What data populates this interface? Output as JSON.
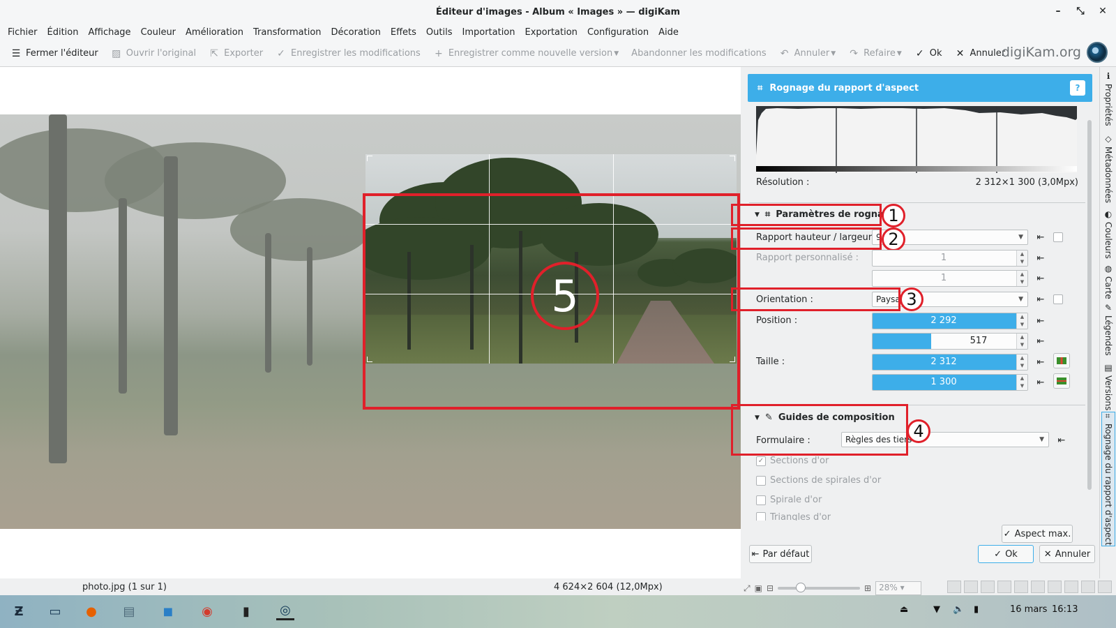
{
  "window": {
    "title": "Éditeur d'images - Album « Images » — digiKam",
    "controls": [
      "–",
      "⤡",
      "✕"
    ]
  },
  "menu": [
    "Fichier",
    "Édition",
    "Affichage",
    "Couleur",
    "Amélioration",
    "Transformation",
    "Décoration",
    "Effets",
    "Outils",
    "Importation",
    "Exportation",
    "Configuration",
    "Aide"
  ],
  "toolbar": {
    "close_editor": "Fermer l'éditeur",
    "open_original": "Ouvrir l'original",
    "export": "Exporter",
    "save_changes": "Enregistrer les modifications",
    "save_new_version": "Enregistrer comme nouvelle version",
    "discard_changes": "Abandonner les modifications",
    "undo": "Annuler",
    "redo": "Refaire",
    "ok": "Ok",
    "cancel": "Annuler",
    "brand": "digiKam.org"
  },
  "panel": {
    "title": "Rognage du rapport d'aspect",
    "help": "?",
    "resolution_label": "Résolution :",
    "resolution_value": "2 312×1 300 (3,0Mpx)",
    "crop_section": "Paramètres de rognage",
    "ratio_label": "Rapport hauteur / largeur :",
    "ratio_value": "9:16",
    "custom_ratio_label": "Rapport personnalisé :",
    "custom_ratio_1": "1",
    "custom_ratio_2": "1",
    "orientation_label": "Orientation :",
    "orientation_value": "Paysage",
    "position_label": "Position :",
    "position_x": "2 292",
    "position_y": "517",
    "size_label": "Taille :",
    "size_w": "2 312",
    "size_h": "1 300",
    "guides_section": "Guides de composition",
    "form_label": "Formulaire :",
    "form_value": "Règles des tiers",
    "checkboxes": [
      {
        "label": "Sections d'or",
        "checked": true
      },
      {
        "label": "Sections de spirales d'or",
        "checked": false
      },
      {
        "label": "Spirale d'or",
        "checked": false
      },
      {
        "label": "Triangles d'or",
        "checked": false
      }
    ],
    "max_aspect": "Aspect max.",
    "default_btn": "Par défaut",
    "ok_btn": "Ok",
    "cancel_btn": "Annuler"
  },
  "callouts": [
    "1",
    "2",
    "3",
    "4",
    "5"
  ],
  "side_tabs": [
    "Propriétés",
    "Métadonnées",
    "Couleurs",
    "Carte",
    "Légendes",
    "Versions",
    "Rognage du rapport d'aspect"
  ],
  "status": {
    "file": "photo.jpg (1 sur 1)",
    "image_size": "4 624×2 604 (12,0Mpx)",
    "zoom": "28%"
  },
  "taskbar": {
    "date": "16 mars",
    "time": "16:13"
  },
  "colors": {
    "accent": "#3daee9",
    "annotation": "#e0202a"
  }
}
